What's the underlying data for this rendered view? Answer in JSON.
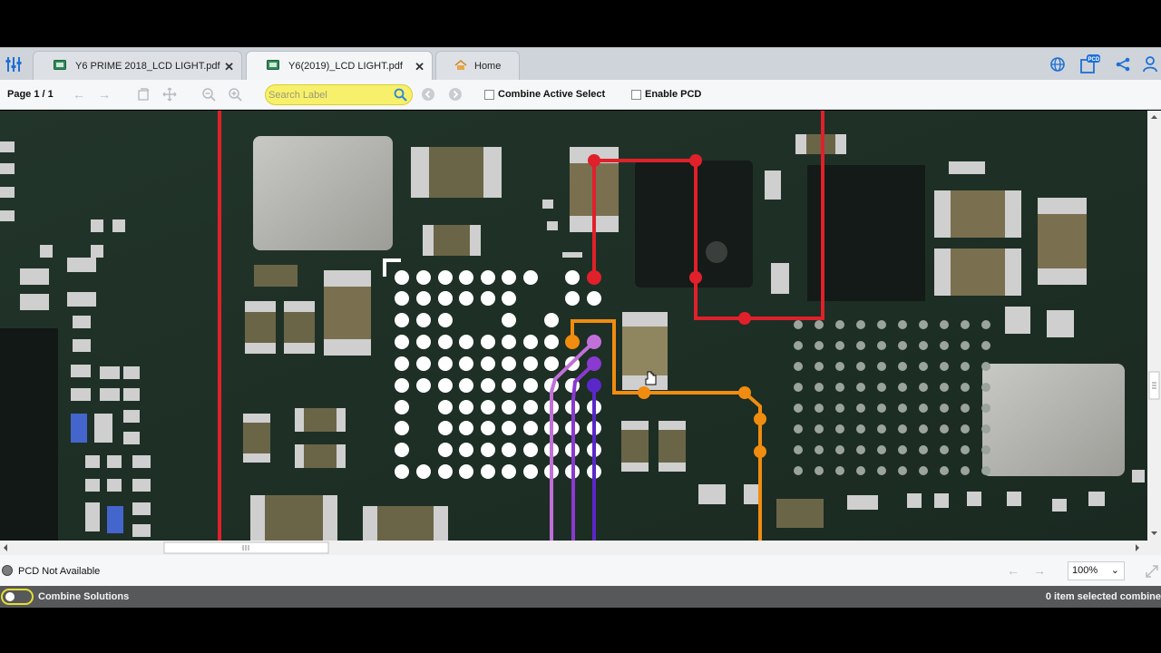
{
  "tabs": [
    {
      "label": "Y6 PRIME 2018_LCD LIGHT.pdf",
      "active": false
    },
    {
      "label": "Y6(2019)_LCD LIGHT.pdf",
      "active": true
    }
  ],
  "home_tab": {
    "label": "Home"
  },
  "toolbar": {
    "page_label": "Page 1 / 1",
    "search_placeholder": "Search Label",
    "combine_active_select": "Combine Active Select",
    "enable_pcd": "Enable PCD"
  },
  "status": {
    "pcd": "PCD Not Available",
    "zoom": "100%"
  },
  "bottom": {
    "combine_solutions": "Combine Solutions",
    "selected": "0 item selected combine"
  },
  "colors": {
    "accent_blue": "#1e6fd6",
    "search_yellow": "#f7f06a",
    "net_red": "#e0202a",
    "net_orange": "#f08c10",
    "net_purple_light": "#c070d8",
    "net_purple": "#8a3ad0",
    "net_violet": "#5a28c8"
  },
  "icons": [
    "settings-sliders-icon",
    "pdf-board-icon",
    "home-icon",
    "globe-icon",
    "pcd-icon",
    "share-icon",
    "user-icon"
  ]
}
